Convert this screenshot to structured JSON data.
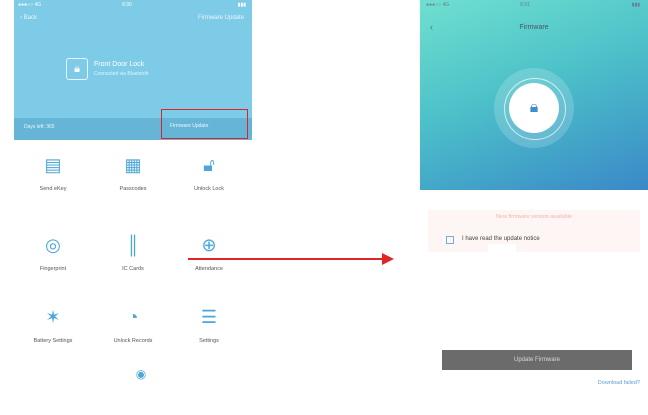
{
  "left_phone": {
    "status": {
      "carrier": "●●●○○ 4G",
      "time": "9:30",
      "battery": "▮▮▮"
    },
    "header": {
      "back_label": "‹ Back",
      "top_right_label": "Firmware Update",
      "lock_name": "Front Door Lock",
      "lock_desc": "Connected via Bluetooth",
      "days_left": "Days left: 365",
      "firmware_label": "Firmware Update"
    },
    "tiles": [
      {
        "label": "Send eKey"
      },
      {
        "label": "Passcodes"
      },
      {
        "label": "Unlock Lock"
      },
      {
        "label": "Fingerprint"
      },
      {
        "label": "IC Cards"
      },
      {
        "label": "Attendance"
      },
      {
        "label": "Battery Settings"
      },
      {
        "label": "Unlock Records"
      },
      {
        "label": "Settings"
      }
    ]
  },
  "right_phone": {
    "status": {
      "carrier": "●●●○○ 4G",
      "time": "9:31",
      "battery": "▮▮▮"
    },
    "title": "Firmware",
    "back_label": "‹",
    "card_heading": "New firmware version available",
    "card_text": "I have read the update notice",
    "card_small": "",
    "update_button": "Update Firmware",
    "help_link": "Download failed?"
  },
  "colors": {
    "accent": "#4aa7d8",
    "highlight": "#d9242a",
    "header": "#7ecbe7"
  }
}
